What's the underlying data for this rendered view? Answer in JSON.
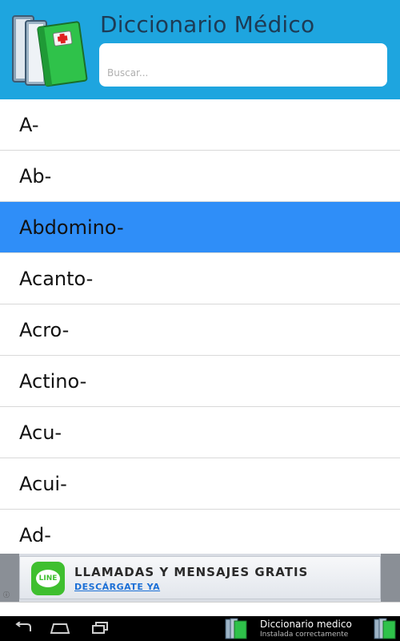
{
  "app": {
    "title": "Diccionario Médico",
    "search_placeholder": "Buscar..."
  },
  "list": {
    "items": [
      "A-",
      "Ab-",
      "Abdomino-",
      "Acanto-",
      "Acro-",
      "Actino-",
      "Acu-",
      "Acui-",
      "Ad-"
    ],
    "selected_index": 2
  },
  "ad": {
    "brand": "LINE",
    "title": "LLAMADAS Y MENSAJES GRATIS",
    "cta": "DESCÁRGATE YA",
    "info": "ⓘ"
  },
  "notification": {
    "title": "Diccionario medico",
    "subtitle": "Instalada correctamente"
  },
  "colors": {
    "header": "#1ea5df",
    "selected_row": "#2f8ef8",
    "title_text": "#1d3b55"
  }
}
